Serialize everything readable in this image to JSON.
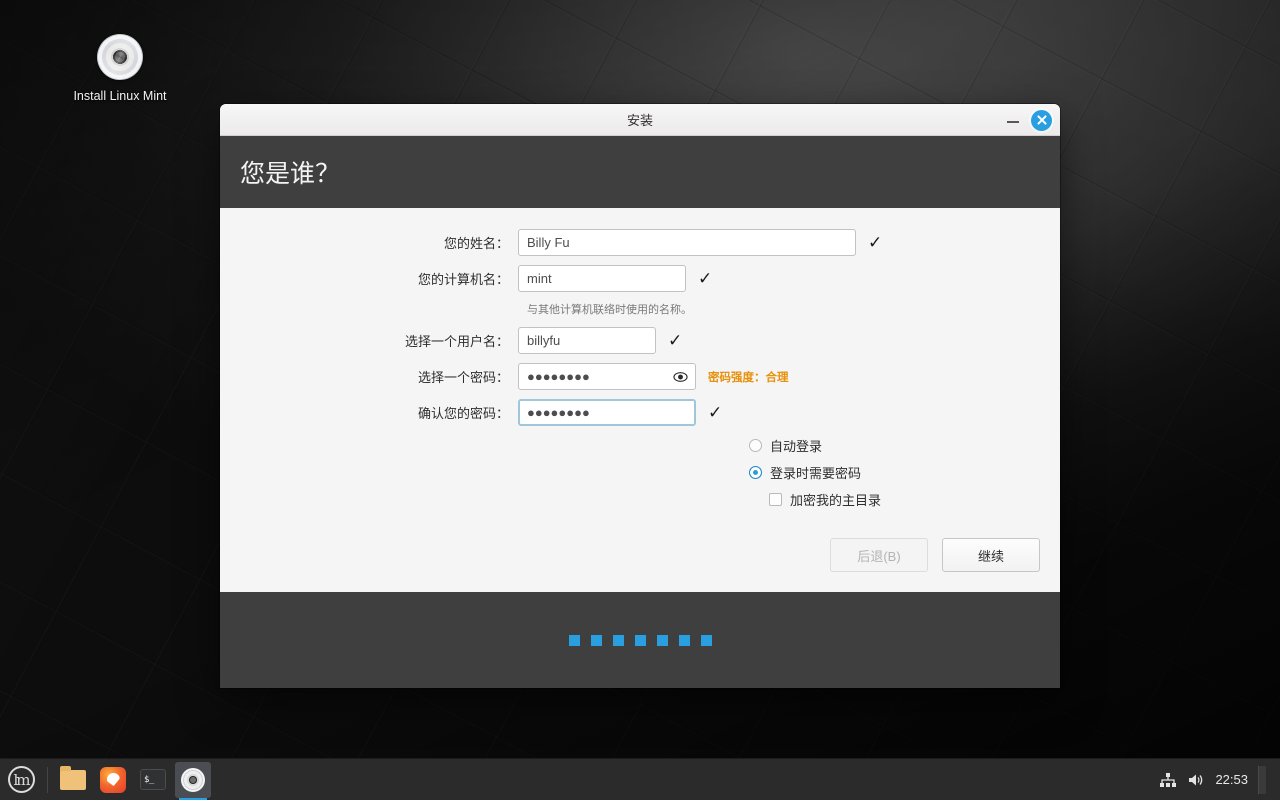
{
  "desktop": {
    "icon": {
      "label": "Install Linux Mint",
      "glyph": "disc-icon"
    }
  },
  "window": {
    "title": "安装",
    "minimize_label": "–",
    "close_label": "✕",
    "heading": "您是谁？"
  },
  "form": {
    "fields": [
      {
        "label": "您的姓名：",
        "value": "Billy Fu",
        "valid": "✓"
      },
      {
        "label": "您的计算机名：",
        "value": "mint",
        "valid": "✓"
      },
      {
        "label": "选择一个用户名：",
        "value": "billyfu",
        "valid": "✓"
      },
      {
        "label": "选择一个密码：",
        "value": "●●●●●●●●",
        "valid": ""
      },
      {
        "label": "确认您的密码：",
        "value": "●●●●●●●●",
        "valid": "✓"
      }
    ],
    "hostname_hint": "与其他计算机联络时使用的名称。",
    "password_strength": "密码强度：合理",
    "password_strength_color": "#e8910c"
  },
  "options": {
    "autologin_label": "自动登录",
    "require_password_label": "登录时需要密码",
    "encrypt_home_label": "加密我的主目录"
  },
  "buttons": {
    "back": "后退(B)",
    "continue": "继续"
  },
  "footer": {
    "dot_count": 7,
    "dot_color": "#2a9fe0"
  },
  "taskbar": {
    "menu": "mint-menu-icon",
    "launchers": [
      {
        "name": "files",
        "icon": "folder-icon"
      },
      {
        "name": "firefox",
        "icon": "firefox-icon"
      },
      {
        "name": "terminal",
        "icon": "terminal-icon",
        "glyph": "$_"
      },
      {
        "name": "installer",
        "icon": "disc-icon",
        "active": true
      }
    ],
    "tray": {
      "network": "network-icon",
      "volume": "volume-icon",
      "clock": "22:53"
    }
  }
}
